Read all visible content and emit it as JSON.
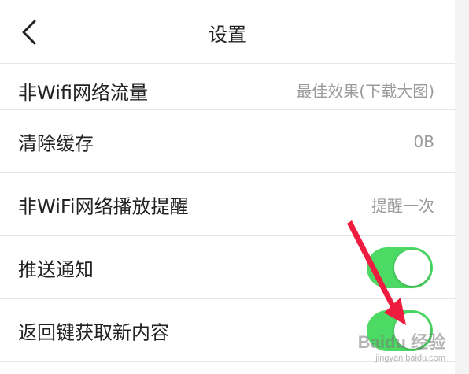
{
  "header": {
    "title": "设置",
    "back_icon": "chevron-left-icon"
  },
  "settings": [
    {
      "label": "非Wifi网络流量",
      "value": "最佳效果(下载大图)"
    },
    {
      "label": "清除缓存",
      "value": "0B"
    },
    {
      "label": "非WiFi网络播放提醒",
      "value": "提醒一次"
    },
    {
      "label": "推送通知",
      "toggle": true
    },
    {
      "label": "返回键获取新内容",
      "toggle": true
    }
  ],
  "watermark": {
    "main": "Baidu 经验",
    "sub": "jingyan.baidu.com"
  },
  "colors": {
    "toggle_on": "#4cd964",
    "arrow": "#ee1c3e",
    "divider": "#e6e6e6",
    "value_text": "#9a9a9a"
  }
}
